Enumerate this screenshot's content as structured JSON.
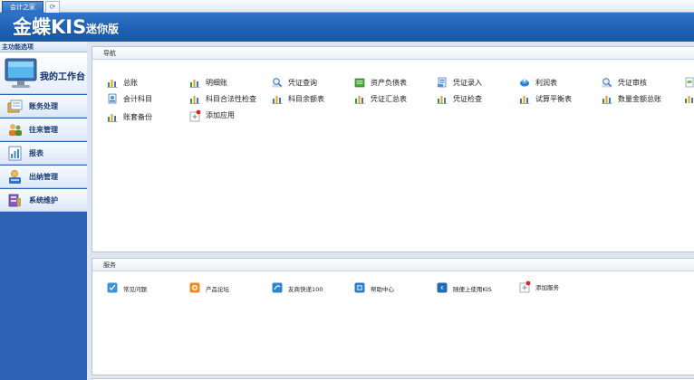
{
  "tabs": [
    {
      "label": "会计之家"
    }
  ],
  "header": {
    "logo": "金蝶KIS",
    "edition": "迷你版"
  },
  "sidebar": {
    "heading": "主功能选项",
    "workbench_label": "我的工作台",
    "items": [
      {
        "label": "账务处理",
        "icon": "ledger-icon"
      },
      {
        "label": "往来管理",
        "icon": "people-icon"
      },
      {
        "label": "报表",
        "icon": "report-icon"
      },
      {
        "label": "出纳管理",
        "icon": "cashier-icon"
      },
      {
        "label": "系统维护",
        "icon": "maintenance-icon"
      }
    ]
  },
  "navigation": {
    "title": "导航",
    "items": [
      {
        "label": "总账",
        "icon": "bar-chart-icon"
      },
      {
        "label": "明细账",
        "icon": "bar-chart-icon"
      },
      {
        "label": "凭证查询",
        "icon": "magnifier-icon"
      },
      {
        "label": "资产负债表",
        "icon": "green-sheet-icon"
      },
      {
        "label": "凭证录入",
        "icon": "voucher-entry-icon"
      },
      {
        "label": "利润表",
        "icon": "profit-icon"
      },
      {
        "label": "凭证审核",
        "icon": "magnifier-icon"
      },
      {
        "label": "会计科目",
        "icon": "account-subject-icon"
      },
      {
        "label": "科目合法性检查",
        "icon": "bar-chart-icon"
      },
      {
        "label": "科目余额表",
        "icon": "bar-chart-icon"
      },
      {
        "label": "凭证汇总表",
        "icon": "bar-chart-icon"
      },
      {
        "label": "凭证检查",
        "icon": "bar-chart-icon"
      },
      {
        "label": "试算平衡表",
        "icon": "bar-chart-icon"
      },
      {
        "label": "数量金额总账",
        "icon": "bar-chart-icon"
      },
      {
        "label": "账套备份",
        "icon": "bar-chart-icon"
      },
      {
        "label": "添加应用",
        "icon": "add-app-icon"
      }
    ]
  },
  "services": {
    "title": "服务",
    "items": [
      {
        "label": "常见问题",
        "icon": "faq-icon"
      },
      {
        "label": "产品论坛",
        "icon": "forum-icon"
      },
      {
        "label": "友商快递100",
        "icon": "express-icon"
      },
      {
        "label": "帮助中心",
        "icon": "help-center-icon"
      },
      {
        "label": "随便上使用KIS",
        "icon": "kis-online-icon"
      },
      {
        "label": "添加服务",
        "icon": "add-service-icon"
      }
    ]
  },
  "colors": {
    "header_blue": "#1e5fb2",
    "sidebar_blue": "#2c63b6",
    "panel_border": "#b7c6d9"
  }
}
